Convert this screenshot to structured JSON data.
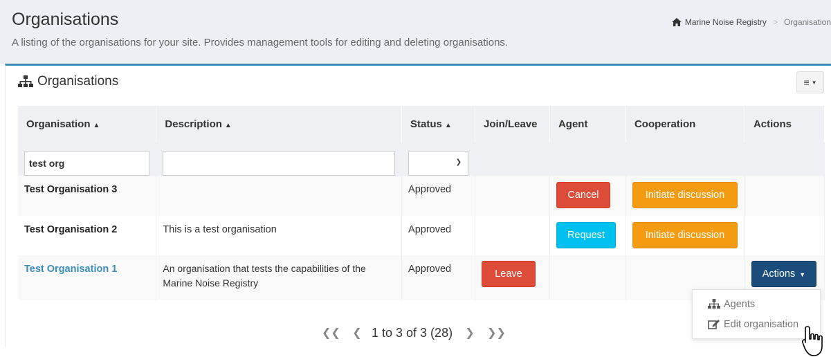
{
  "header": {
    "title": "Organisations",
    "subtitle": "A listing of the organisations for your site. Provides management tools for editing and deleting organisations."
  },
  "breadcrumb": {
    "home": "Marine Noise Registry",
    "separator": ">",
    "current": "Organisation"
  },
  "box": {
    "title": "Organisations",
    "tools_icon": "bars-icon"
  },
  "table": {
    "columns": {
      "organisation": "Organisation",
      "description": "Description",
      "status": "Status",
      "join_leave": "Join/Leave",
      "agent": "Agent",
      "cooperation": "Cooperation",
      "actions": "Actions"
    },
    "filters": {
      "organisation_value": "test org",
      "description_value": "",
      "status_value": ""
    },
    "rows": [
      {
        "name": "Test Organisation 3",
        "description": "",
        "status": "Approved",
        "join_leave": "",
        "agent": "Cancel",
        "cooperation": "Initiate discussion",
        "actions": ""
      },
      {
        "name": "Test Organisation 2",
        "description": "This is a test organisation",
        "status": "Approved",
        "join_leave": "",
        "agent": "Request",
        "cooperation": "Initiate discussion",
        "actions": ""
      },
      {
        "name": "Test Organisation 1",
        "description_line1": "An organisation that tests the capabilities of the",
        "description_line2": "Marine Noise Registry",
        "status": "Approved",
        "join_leave": "Leave",
        "agent": "",
        "cooperation": "",
        "actions": "Actions"
      }
    ]
  },
  "actions_menu": {
    "items": [
      "Agents",
      "Edit organisation"
    ]
  },
  "pagination": {
    "summary": "1 to 3 of 3 (28)"
  },
  "colors": {
    "primary": "#3c8dbc",
    "danger": "#dd4b39",
    "info": "#00c0ef",
    "warning": "#f39c12",
    "navy": "#1a4d7c"
  }
}
